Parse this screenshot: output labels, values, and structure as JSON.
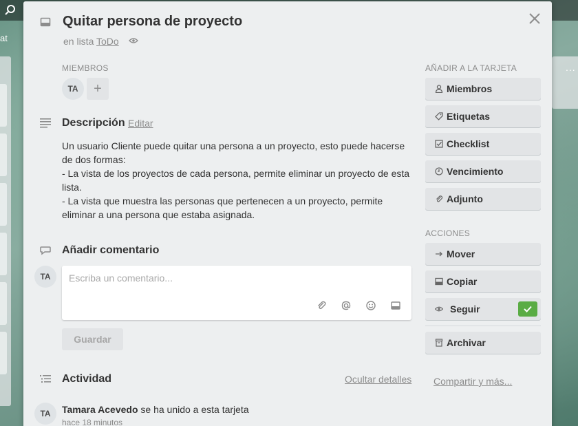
{
  "background": {
    "board_title_fragment": "at",
    "menu_dots": "..."
  },
  "card": {
    "title": "Quitar persona de proyecto",
    "in_list_prefix": "en lista",
    "list_name": "ToDo"
  },
  "members": {
    "label": "MIEMBROS",
    "avatar_initials": "TA",
    "add_symbol": "+"
  },
  "description": {
    "heading": "Descripción",
    "edit_label": "Editar",
    "lines": [
      "Un usuario Cliente puede quitar una persona a un proyecto, esto puede hacerse de dos formas:",
      "- La vista de los proyectos de cada persona, permite eliminar un proyecto de esta lista.",
      "- La vista que muestra las personas que pertenecen a un proyecto, permite eliminar a una persona que estaba asignada."
    ]
  },
  "comment": {
    "heading": "Añadir comentario",
    "avatar_initials": "TA",
    "placeholder": "Escriba un comentario...",
    "save_label": "Guardar"
  },
  "activity": {
    "heading": "Actividad",
    "hide_details_label": "Ocultar detalles",
    "avatar_initials": "TA",
    "entries": [
      {
        "user": "Tamara Acevedo",
        "action": "se ha unido a esta tarjeta",
        "time": "hace 18 minutos"
      }
    ]
  },
  "sidebar": {
    "add_label": "AÑADIR A LA TARJETA",
    "add_buttons": [
      {
        "label": "Miembros",
        "icon": "person-icon"
      },
      {
        "label": "Etiquetas",
        "icon": "tag-icon"
      },
      {
        "label": "Checklist",
        "icon": "checkbox-icon"
      },
      {
        "label": "Vencimiento",
        "icon": "clock-icon"
      },
      {
        "label": "Adjunto",
        "icon": "paperclip-icon"
      }
    ],
    "actions_label": "ACCIONES",
    "action_buttons": [
      {
        "label": "Mover",
        "icon": "arrow-right-icon"
      },
      {
        "label": "Copiar",
        "icon": "card-icon"
      },
      {
        "label": "Seguir",
        "icon": "eye-icon",
        "active": true
      }
    ],
    "archive_label": "Archivar",
    "share_label": "Compartir y más..."
  },
  "colors": {
    "modal_bg": "#edeff0",
    "button_bg": "#e2e4e6",
    "check_green": "#5aac44",
    "muted_text": "#8c8c8c"
  }
}
